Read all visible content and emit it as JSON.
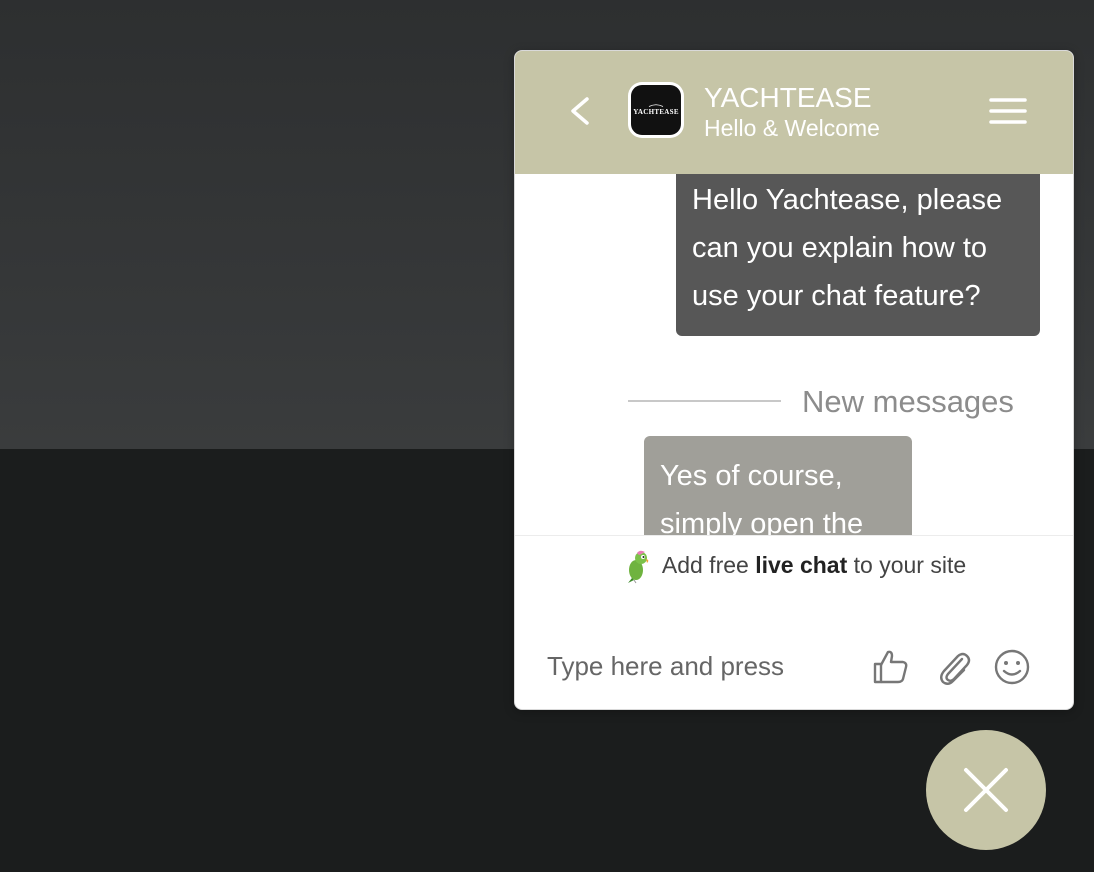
{
  "header": {
    "title": "YACHTEASE",
    "subtitle": "Hello & Welcome",
    "avatar_text": "YACHTEASE",
    "back_icon": "chevron-left-icon",
    "menu_icon": "hamburger-menu-icon"
  },
  "messages": {
    "outgoing_text": "Hello Yachtease, please can you explain how to use your chat feature?",
    "divider_label": "New messages",
    "incoming_text": "Yes of course, simply open the"
  },
  "promo": {
    "prefix": "Add free ",
    "bold": "live chat",
    "suffix": " to your site",
    "icon": "parrot-icon"
  },
  "composer": {
    "placeholder": "Type here and press",
    "icons": [
      "thumbs-up-icon",
      "paperclip-icon",
      "emoji-icon"
    ]
  },
  "fab": {
    "icon": "close-icon"
  },
  "colors": {
    "accent": "#c6c5a7",
    "outgoing_bubble": "#575757",
    "incoming_bubble": "#a09f99"
  }
}
